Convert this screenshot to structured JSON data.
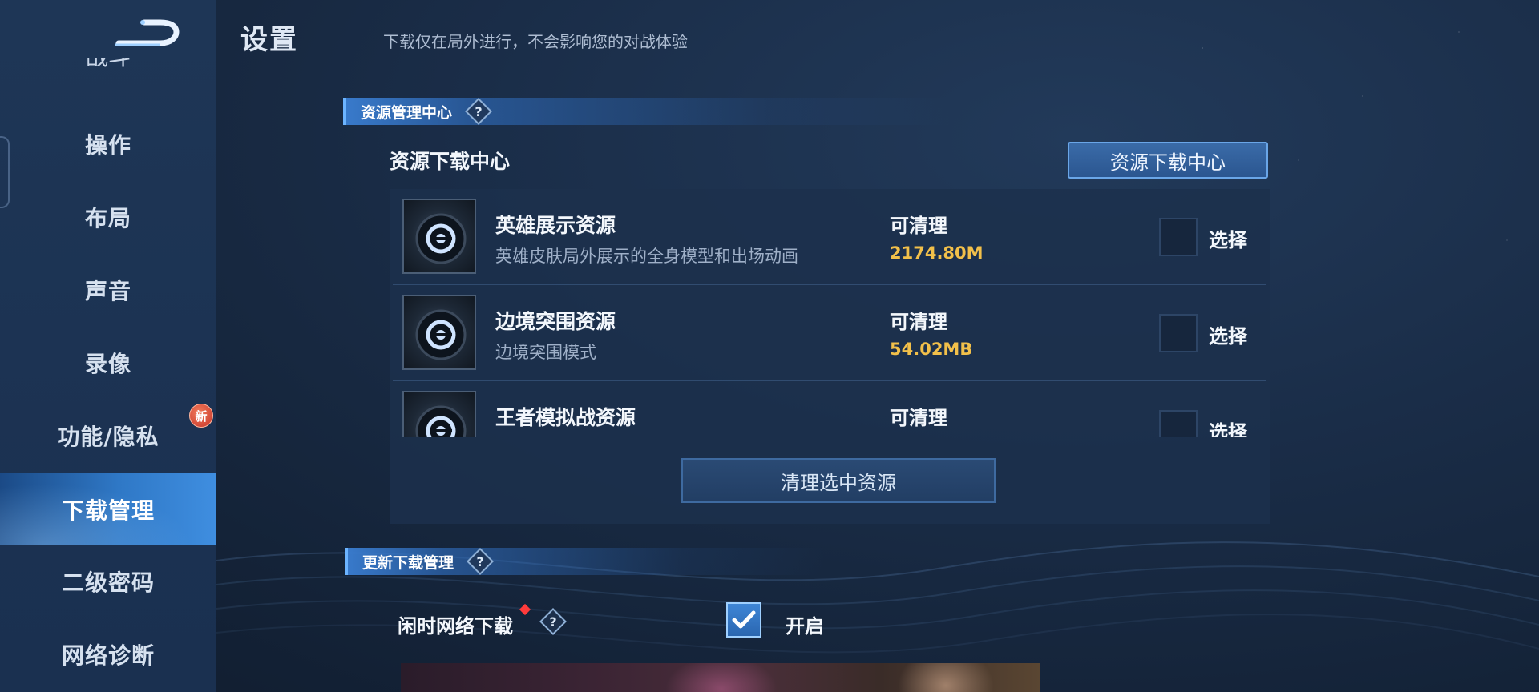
{
  "header": {
    "title": "设置",
    "subtitle": "下载仅在局外进行，不会影响您的对战体验"
  },
  "sidebar": {
    "partial_item": "战斗",
    "items": [
      {
        "label": "操作"
      },
      {
        "label": "布局"
      },
      {
        "label": "声音"
      },
      {
        "label": "录像"
      },
      {
        "label": "功能/隐私",
        "badge": "新"
      },
      {
        "label": "下载管理",
        "active": true
      },
      {
        "label": "二级密码"
      },
      {
        "label": "网络诊断"
      }
    ]
  },
  "resource_section": {
    "title": "资源管理中心",
    "sub_heading": "资源下载中心",
    "center_button": "资源下载中心",
    "items": [
      {
        "title": "英雄展示资源",
        "desc": "英雄皮肤局外展示的全身模型和出场动画",
        "status": "可清理",
        "size": "2174.80M",
        "select_label": "选择"
      },
      {
        "title": "边境突围资源",
        "desc": "边境突围模式",
        "status": "可清理",
        "size": "54.02MB",
        "select_label": "选择"
      },
      {
        "title": "王者模拟战资源",
        "desc": "",
        "status": "可清理",
        "size": "",
        "select_label": "选择"
      }
    ],
    "clean_button": "清理选中资源"
  },
  "update_section": {
    "title": "更新下载管理",
    "idle_label": "闲时网络下载",
    "toggle_label": "开启",
    "toggle_checked": true
  },
  "colors": {
    "accent": "#3f8ee0",
    "size_text": "#f2c04a",
    "badge": "#c7352a"
  },
  "icons": {
    "back": "back-arrow-icon",
    "help": "question-icon",
    "resource": "resource-disc-icon",
    "check": "checkmark-icon"
  }
}
